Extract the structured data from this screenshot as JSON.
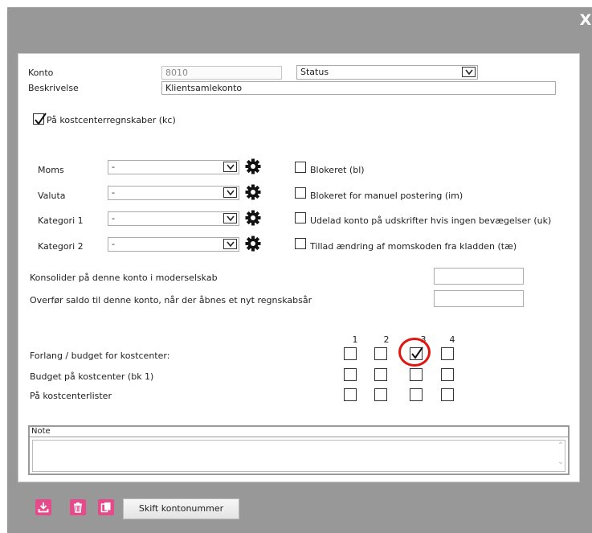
{
  "dialog": {
    "close_label": "X"
  },
  "form": {
    "konto_label": "Konto",
    "konto_value": "8010",
    "status_value": "Status",
    "beskrivelse_label": "Beskrivelse",
    "beskrivelse_value": "Klientsamlekonto",
    "kc_label": "På kostcenterregnskaber (kc)",
    "kc_checked": true
  },
  "fields": [
    {
      "label": "Moms",
      "value": "-"
    },
    {
      "label": "Valuta",
      "value": "-"
    },
    {
      "label": "Kategori 1",
      "value": "-"
    },
    {
      "label": "Kategori 2",
      "value": "-"
    }
  ],
  "flags": [
    {
      "label": "Blokeret (bl)",
      "checked": false
    },
    {
      "label": "Blokeret for manuel postering (im)",
      "checked": false
    },
    {
      "label": "Udelad konto på udskrifter hvis ingen bevægelser (uk)",
      "checked": false
    },
    {
      "label": "Tillad ændring af momskoden fra kladden (tæ)",
      "checked": false
    }
  ],
  "konsolider": {
    "label": "Konsolider på denne konto i moderselskab",
    "value": ""
  },
  "overfoer": {
    "label": "Overfør saldo til denne konto, når der åbnes et nyt regnskabsår",
    "value": ""
  },
  "costcenter": {
    "headers": [
      "1",
      "2",
      "3",
      "4"
    ],
    "rows": [
      {
        "label": "Forlang / budget for kostcenter:",
        "checks": [
          false,
          false,
          true,
          false
        ]
      },
      {
        "label": "Budget på kostcenter (bk 1)",
        "checks": [
          false,
          false,
          false,
          false
        ]
      },
      {
        "label": "På kostcenterlister",
        "checks": [
          false,
          false,
          false,
          false
        ]
      }
    ]
  },
  "note": {
    "title": "Note",
    "value": ""
  },
  "footer": {
    "download_icon": "download-icon",
    "delete_icon": "trash-icon",
    "copy_icon": "copy-icon",
    "change_account_label": "Skift kontonummer",
    "accent": "#e64a8b"
  },
  "annotation": {
    "highlight_color": "#e3140f"
  }
}
